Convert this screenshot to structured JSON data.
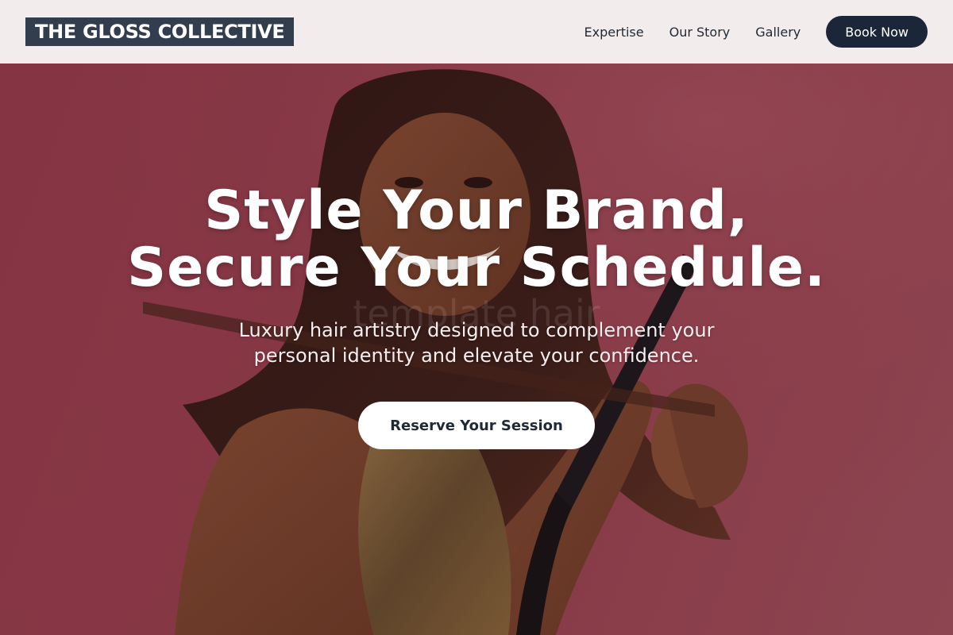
{
  "brand": {
    "name": "THE GLOSS COLLECTIVE"
  },
  "nav": {
    "items": [
      {
        "label": "Expertise"
      },
      {
        "label": "Our Story"
      },
      {
        "label": "Gallery"
      }
    ],
    "cta_label": "Book Now"
  },
  "hero": {
    "title_line1": "Style Your Brand,",
    "title_line2": "Secure Your Schedule.",
    "watermark": "template hair",
    "subtitle": "Luxury hair artistry designed to complement your personal identity and elevate your confidence.",
    "cta_label": "Reserve Your Session",
    "image": "hero-photo-woman-straightening-hair"
  },
  "colors": {
    "header_bg": "#f3ecec",
    "logo_bg": "#323d4e",
    "button_dark": "#1b2638",
    "hero_bg": "#9b4350",
    "cta_bg": "#ffffff"
  }
}
